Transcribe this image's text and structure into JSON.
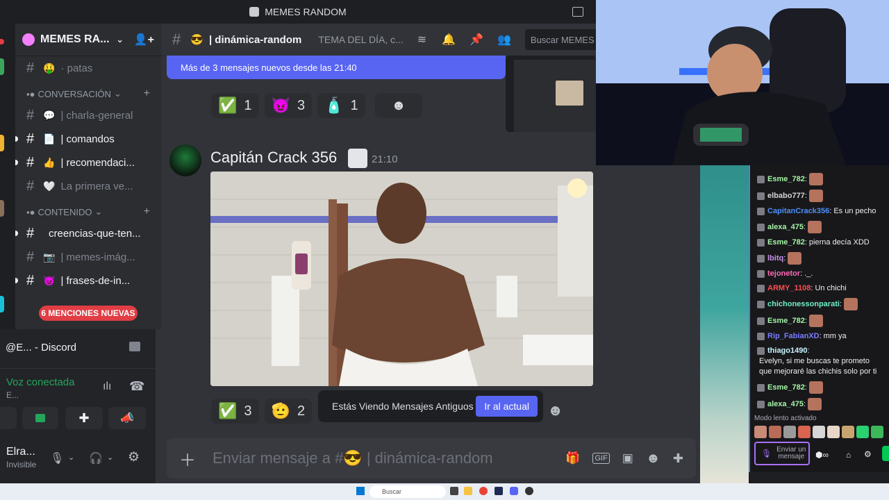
{
  "window_title": "MEMES RANDOM",
  "server": {
    "name": "MEMES RA..."
  },
  "channels": [
    {
      "emoji": "🤑",
      "name": "· patas",
      "bright": false
    },
    {
      "category": "CONVERSACIÓN"
    },
    {
      "emoji": "💬",
      "name": "| charla-general",
      "bright": false
    },
    {
      "emoji": "📄",
      "name": "| comandos",
      "bright": true
    },
    {
      "emoji": "👍",
      "name": "| recomendaci...",
      "bright": true
    },
    {
      "emoji": "🤍",
      "name": "La primera ve...",
      "bright": false
    },
    {
      "category": "CONTENIDO"
    },
    {
      "emoji": "",
      "name": "creencias-que-ten...",
      "bright": true
    },
    {
      "emoji": "📷",
      "name": "| memes-imág...",
      "bright": false
    },
    {
      "emoji": "😈",
      "name": "| frases-de-in...",
      "bright": true
    }
  ],
  "mentions_badge": "6 MENCIONES NUEVAS",
  "voice": {
    "call_title": "@E... - Discord",
    "status": "Voz conectada",
    "channel": "E...",
    "user_name": "Elra...",
    "user_status": "Invisible"
  },
  "channel_header": {
    "emoji": "😎",
    "name": "| dinámica-random",
    "topic": "TEMA DEL DÍA, c...",
    "search_placeholder": "Buscar MEMES"
  },
  "new_messages_banner": "Más de 3 mensajes nuevos desde las 21:40",
  "reactions_top": [
    {
      "emoji": "✅",
      "count": "1"
    },
    {
      "emoji": "😈",
      "count": "3"
    },
    {
      "emoji": "🧴",
      "count": "1"
    }
  ],
  "message": {
    "author": "Capitán Crack 356",
    "time": "21:10"
  },
  "reactions_bottom": [
    {
      "emoji": "✅",
      "count": "3"
    },
    {
      "emoji": "🫡",
      "count": "2"
    }
  ],
  "old_messages_bar": {
    "text": "Estás Viendo Mensajes Antiguos",
    "button": "Ir al actual"
  },
  "composer": {
    "placeholder": "Enviar mensaje a #😎 | dinámica-random"
  },
  "chat": {
    "lines": [
      {
        "user": "Esme_782",
        "color": "#a4f5a4",
        "text": "",
        "emote": true
      },
      {
        "user": "elbabo777",
        "color": "#d6d6d6",
        "text": "",
        "emote": true
      },
      {
        "user": "CapitanCrack356",
        "color": "#4f8ff7",
        "text": "Es un pecho",
        "emote": false
      },
      {
        "user": "alexa_475",
        "color": "#a4f5a4",
        "text": "",
        "emote": true
      },
      {
        "user": "Esme_782",
        "color": "#a4f5a4",
        "text": "pierna decía XDD",
        "emote": false
      },
      {
        "user": "lbitq",
        "color": "#c792ea",
        "text": "",
        "emote": true
      },
      {
        "user": "tejonetor",
        "color": "#ff69b4",
        "text": "._.",
        "emote": false
      },
      {
        "user": "ARMY_1108",
        "color": "#ff4d4d",
        "text": "Un chichi",
        "emote": false
      },
      {
        "user": "chichonessonparati",
        "color": "#6ef0c8",
        "text": "",
        "emote": true
      },
      {
        "user": "Esme_782",
        "color": "#a4f5a4",
        "text": "",
        "emote": true
      },
      {
        "user": "Rip_FabianXD",
        "color": "#7b7bff",
        "text": "mm ya",
        "emote": false
      },
      {
        "user": "thiago1490",
        "color": "#c8f5ff",
        "text": "Evelyn, si me buscas te prometo que mejoraré las chichis solo por ti",
        "emote": false
      },
      {
        "user": "Esme_782",
        "color": "#a4f5a4",
        "text": "",
        "emote": true
      },
      {
        "user": "alexa_475",
        "color": "#a4f5a4",
        "text": "",
        "emote": true
      }
    ],
    "slow_mode": "Modo lento activado",
    "input_placeholder": "Enviar un mensaje"
  },
  "taskbar": {
    "search_placeholder": "Buscar"
  },
  "colors": {
    "blurple": "#5865f2",
    "mention_red": "#e13d44",
    "voice_green": "#23a55a"
  }
}
